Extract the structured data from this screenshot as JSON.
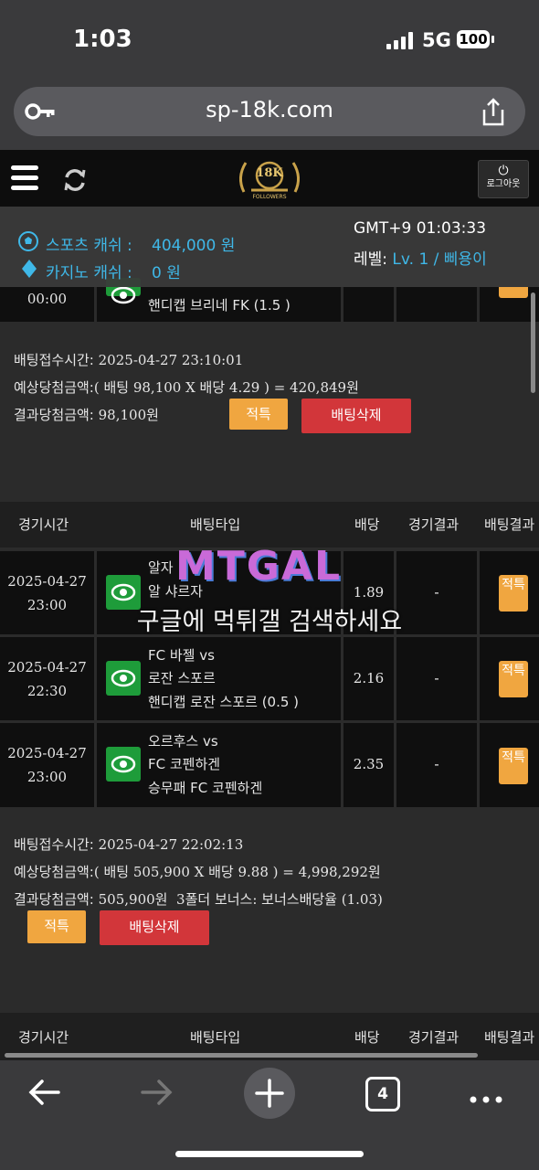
{
  "status_bar": {
    "time": "1:03",
    "network": "5G",
    "battery": "100"
  },
  "browser": {
    "url": "sp-18k.com",
    "tab_count": "4"
  },
  "site_header": {
    "logo_text": "18K",
    "logo_sub": "FOLLOWERS",
    "logout_label": "로그아웃"
  },
  "info_bar": {
    "sports_cash_label": "스포츠 캐쉬 :",
    "sports_cash_value": "404,000 원",
    "casino_cash_label": "카지노 캐쉬 :",
    "casino_cash_value": "0 원",
    "timezone": "GMT+9 01:03:33",
    "level_label": "레벨:",
    "level_value": "Lv. 1 / 삐용이"
  },
  "table_headers": {
    "time": "경기시간",
    "bet_type": "배팅타입",
    "odds": "배당",
    "game_result": "경기결과",
    "bet_result": "배팅결과"
  },
  "slip1": {
    "partial_row": {
      "time": "00:00",
      "desc": "핸디캡 브리네 FK (1.5 )"
    },
    "bet_time_label": "배팅접수시간:",
    "bet_time_value": "2025-04-27 23:10:01",
    "expected_label": "예상당첨금액:",
    "expected_value": "( 배팅 98,100 X 배당 4.29 ) = 420,849원",
    "result_label": "결과당첨금액:",
    "result_value": "98,100원",
    "status_button": "적특",
    "delete_button": "배팅삭제"
  },
  "slip2": {
    "rows": [
      {
        "date": "2025-04-27",
        "time": "23:00",
        "line1": "알자",
        "line2": "알 샤르자",
        "line3": "",
        "odds": "1.89",
        "game_result": "-",
        "bet_result": "적특"
      },
      {
        "date": "2025-04-27",
        "time": "22:30",
        "line1": "FC 바젤 vs",
        "line2": "로잔 스포르",
        "line3": "핸디캡 로잔 스포르 (0.5 )",
        "odds": "2.16",
        "game_result": "-",
        "bet_result": "적특"
      },
      {
        "date": "2025-04-27",
        "time": "23:00",
        "line1": "오르후스 vs",
        "line2": "FC 코펜하겐",
        "line3": "승무패 FC 코펜하겐",
        "odds": "2.35",
        "game_result": "-",
        "bet_result": "적특"
      }
    ],
    "bet_time_label": "배팅접수시간:",
    "bet_time_value": "2025-04-27 22:02:13",
    "expected_label": "예상당첨금액:",
    "expected_value": "( 배팅 505,900 X 배당 9.88 ) = 4,998,292원",
    "result_label": "결과당첨금액:",
    "result_value": "505,900원",
    "bonus_text": "3폴더 보너스: 보너스배당율 (1.03)",
    "status_button": "적특",
    "delete_button": "배팅삭제"
  },
  "watermark": {
    "logo": "MTGAL",
    "text": "구글에 먹튀갤 검색하세요"
  },
  "colors": {
    "accent_blue": "#3fb8e8",
    "orange": "#f0a640",
    "red": "#d2363a",
    "green": "#1e9c3a"
  }
}
